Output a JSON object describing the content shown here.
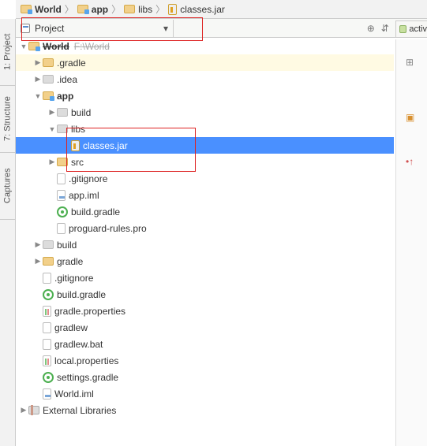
{
  "breadcrumb": [
    {
      "label": "World",
      "bold": true,
      "icon": "module"
    },
    {
      "label": "app",
      "bold": true,
      "icon": "module"
    },
    {
      "label": "libs",
      "bold": false,
      "icon": "folder"
    },
    {
      "label": "classes.jar",
      "bold": false,
      "icon": "jar"
    }
  ],
  "dropdown": {
    "label": "Project"
  },
  "side_tabs": [
    "1: Project",
    "7: Structure",
    "Captures"
  ],
  "right_tab": "activ",
  "tree": [
    {
      "depth": 1,
      "twisty": "down",
      "icon": "module",
      "label": "World",
      "sub": "F:\\World",
      "bold": true,
      "cls": "strike"
    },
    {
      "depth": 2,
      "twisty": "right",
      "icon": "folder",
      "label": ".gradle",
      "hl": true
    },
    {
      "depth": 2,
      "twisty": "right",
      "icon": "folder-c",
      "label": ".idea"
    },
    {
      "depth": 2,
      "twisty": "down",
      "icon": "module",
      "label": "app",
      "bold": true
    },
    {
      "depth": 3,
      "twisty": "right",
      "icon": "folder-c",
      "label": "build"
    },
    {
      "depth": 3,
      "twisty": "down",
      "icon": "folder-c",
      "label": "libs"
    },
    {
      "depth": 4,
      "twisty": "",
      "icon": "jar",
      "label": "classes.jar",
      "sel": true
    },
    {
      "depth": 3,
      "twisty": "right",
      "icon": "folder",
      "label": "src"
    },
    {
      "depth": 3,
      "twisty": "",
      "icon": "file",
      "label": ".gitignore"
    },
    {
      "depth": 3,
      "twisty": "",
      "icon": "file-i",
      "label": "app.iml"
    },
    {
      "depth": 3,
      "twisty": "",
      "icon": "gradle",
      "label": "build.gradle"
    },
    {
      "depth": 3,
      "twisty": "",
      "icon": "file",
      "label": "proguard-rules.pro"
    },
    {
      "depth": 2,
      "twisty": "right",
      "icon": "folder-c",
      "label": "build"
    },
    {
      "depth": 2,
      "twisty": "right",
      "icon": "folder",
      "label": "gradle"
    },
    {
      "depth": 2,
      "twisty": "",
      "icon": "file",
      "label": ".gitignore"
    },
    {
      "depth": 2,
      "twisty": "",
      "icon": "gradle",
      "label": "build.gradle"
    },
    {
      "depth": 2,
      "twisty": "",
      "icon": "prop",
      "label": "gradle.properties"
    },
    {
      "depth": 2,
      "twisty": "",
      "icon": "file",
      "label": "gradlew"
    },
    {
      "depth": 2,
      "twisty": "",
      "icon": "file",
      "label": "gradlew.bat"
    },
    {
      "depth": 2,
      "twisty": "",
      "icon": "prop",
      "label": "local.properties"
    },
    {
      "depth": 2,
      "twisty": "",
      "icon": "gradle",
      "label": "settings.gradle"
    },
    {
      "depth": 2,
      "twisty": "",
      "icon": "file-i",
      "label": "World.iml"
    },
    {
      "depth": 1,
      "twisty": "right",
      "icon": "lib",
      "label": "External Libraries"
    }
  ]
}
